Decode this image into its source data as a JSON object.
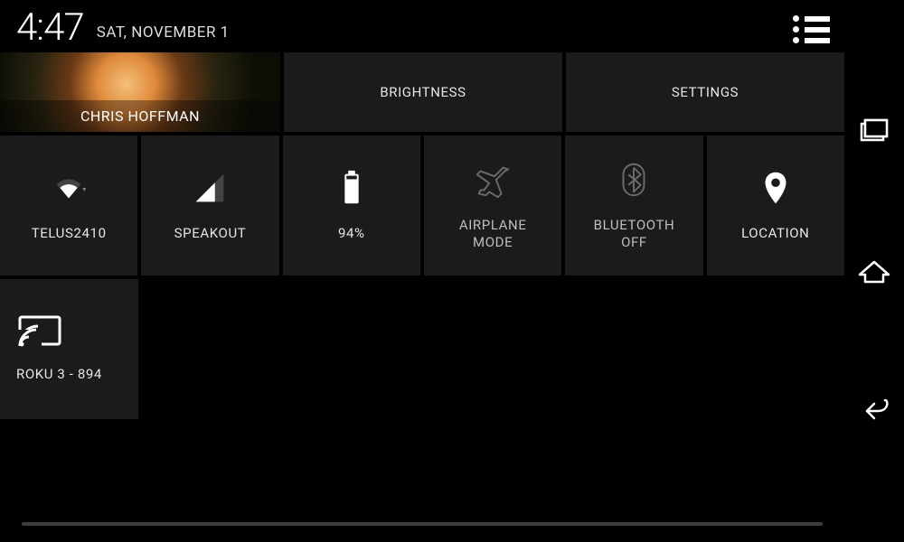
{
  "status": {
    "time": "4:47",
    "date": "SAT, NOVEMBER 1"
  },
  "user": {
    "name": "CHRIS HOFFMAN"
  },
  "tiles": {
    "brightness": "BRIGHTNESS",
    "settings": "SETTINGS",
    "wifi": "TELUS2410",
    "cellular": "SPEAKOUT",
    "battery": "94%",
    "airplane": "AIRPLANE\nMODE",
    "bluetooth": "BLUETOOTH\nOFF",
    "location": "LOCATION",
    "cast": "ROKU 3 - 894"
  }
}
